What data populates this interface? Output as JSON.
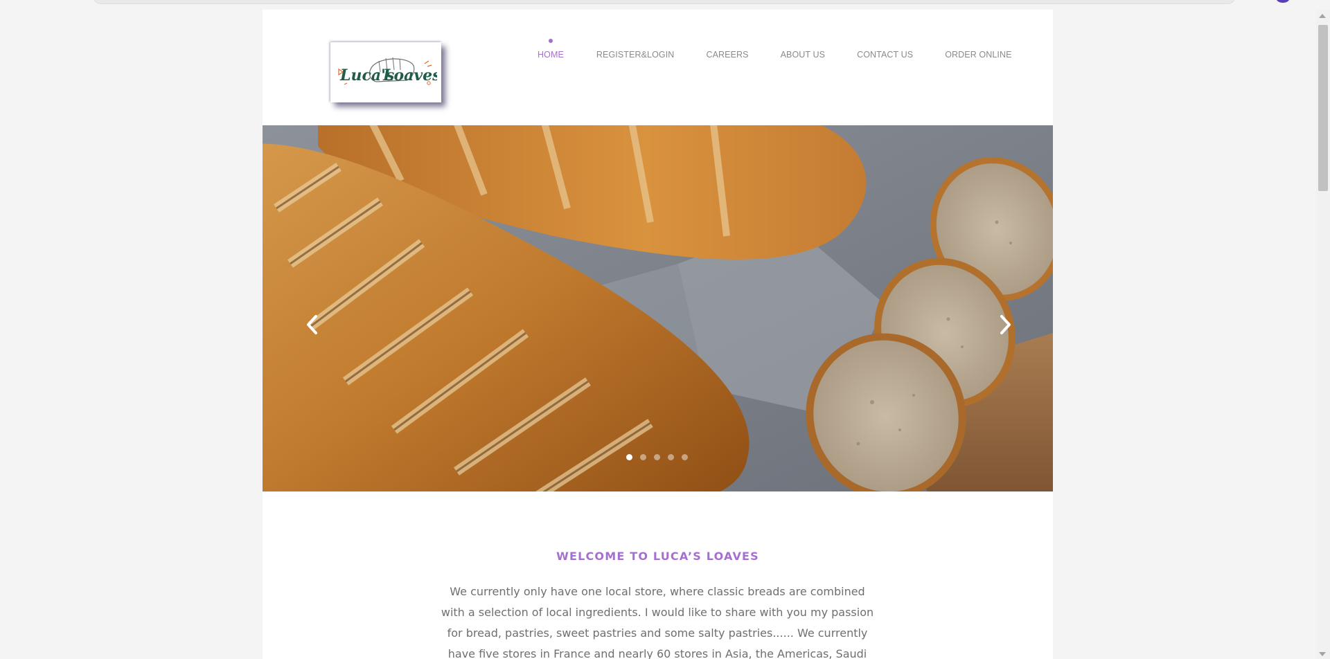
{
  "brand": {
    "logo_text": "Luca's Loaves",
    "logo_alt": "Luca's Loaves logo"
  },
  "nav": {
    "items": [
      {
        "label": "HOME",
        "active": true
      },
      {
        "label": "REGISTER&LOGIN",
        "active": false
      },
      {
        "label": "CAREERS",
        "active": false
      },
      {
        "label": "ABOUT US",
        "active": false
      },
      {
        "label": "CONTACT US",
        "active": false
      },
      {
        "label": "ORDER ONLINE",
        "active": false
      }
    ]
  },
  "slider": {
    "prev_icon": "chevron-left-icon",
    "next_icon": "chevron-right-icon",
    "slide_count": 5,
    "current_slide": 1
  },
  "welcome": {
    "title": "WELCOME TO LUCA’S LOAVES",
    "text": "We currently only have one local store, where classic breads are combined with a selection of local ingredients. I would like to share with you my passion for bread, pastries, sweet pastries and some salty pastries...... We currently have five stores in France and nearly 60 stores in Asia, the Americas, Saudi Arabia and Australia. In our"
  },
  "colors": {
    "accent": "#a56fcf",
    "nav_text": "#8a8a8a",
    "body_text": "#6f6f6f",
    "page_bg": "#f5f4f5"
  }
}
